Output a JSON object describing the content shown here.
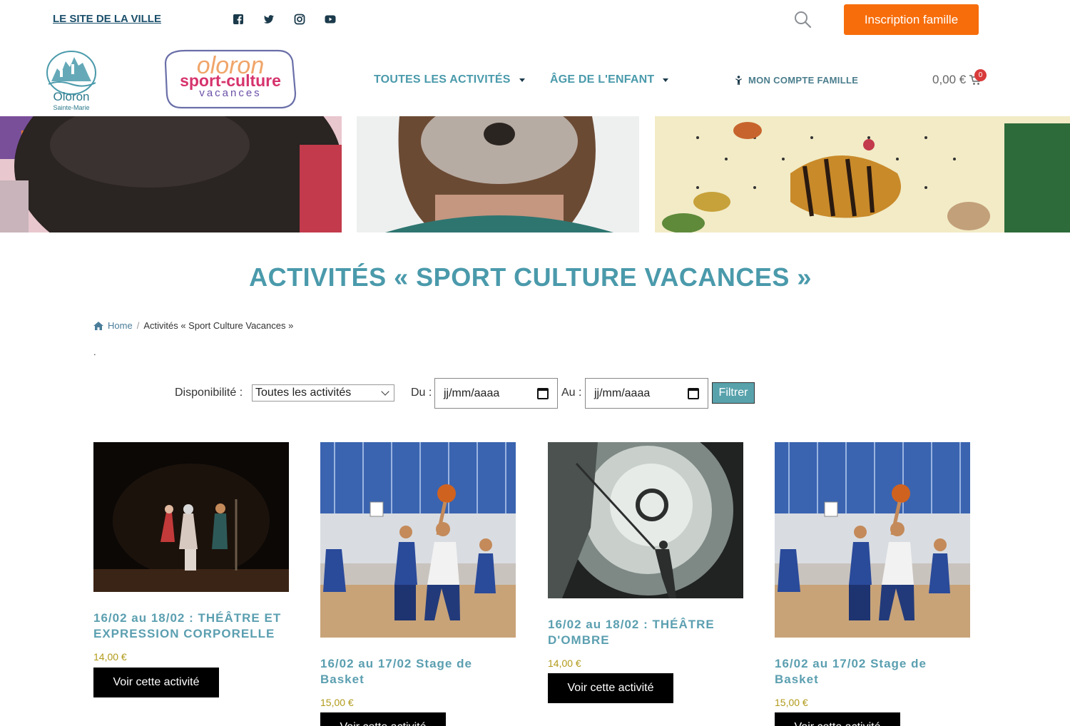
{
  "topbar": {
    "city_link": "LE SITE DE LA VILLE",
    "social_icons": [
      "facebook-icon",
      "twitter-icon",
      "instagram-icon",
      "youtube-icon"
    ],
    "signup_label": "Inscription famille"
  },
  "header": {
    "city_logo_text": "Oloron",
    "city_logo_subtext": "Sainte-Marie",
    "brand_logo_lines": [
      "oloron",
      "sport-culture",
      "vacances"
    ],
    "nav": [
      {
        "label": "TOUTES LES ACTIVITÉS"
      },
      {
        "label": "ÂGE DE L'ENFANT"
      }
    ],
    "account_label": "MON COMPTE FAMILLE",
    "cart_amount": "0,00 €",
    "cart_badge": "0"
  },
  "page": {
    "title": "ACTIVITÉS « SPORT CULTURE VACANCES »",
    "breadcrumb_home": "Home",
    "breadcrumb_sep": "/",
    "breadcrumb_current": "Activités « Sport Culture Vacances »",
    "stray_dot": "."
  },
  "filter": {
    "availability_label": "Disponibilité :",
    "availability_value": "Toutes les activités",
    "from_label": "Du :",
    "from_value": "jj/mm/aaaa",
    "to_label": "Au :",
    "to_value": "jj/mm/aaaa",
    "submit_label": "Filtrer"
  },
  "products": [
    {
      "title": "16/02 au 18/02 : THÉÂTRE ET EXPRESSION CORPORELLE",
      "price": "14,00 €",
      "button": "Voir cette activité"
    },
    {
      "title": "16/02 au 17/02 Stage de Basket",
      "price": "15,00 €",
      "button": "Voir cette activité"
    },
    {
      "title": "16/02 au 18/02 : THÉÂTRE D'OMBRE",
      "price": "14,00 €",
      "button": "Voir cette activité"
    },
    {
      "title": "16/02 au 17/02 Stage de Basket",
      "price": "15,00 €",
      "button": "Voir cette activité"
    }
  ],
  "colors": {
    "accent": "#4a9aab",
    "cta": "#f76d0b",
    "price": "#b19a1a"
  }
}
